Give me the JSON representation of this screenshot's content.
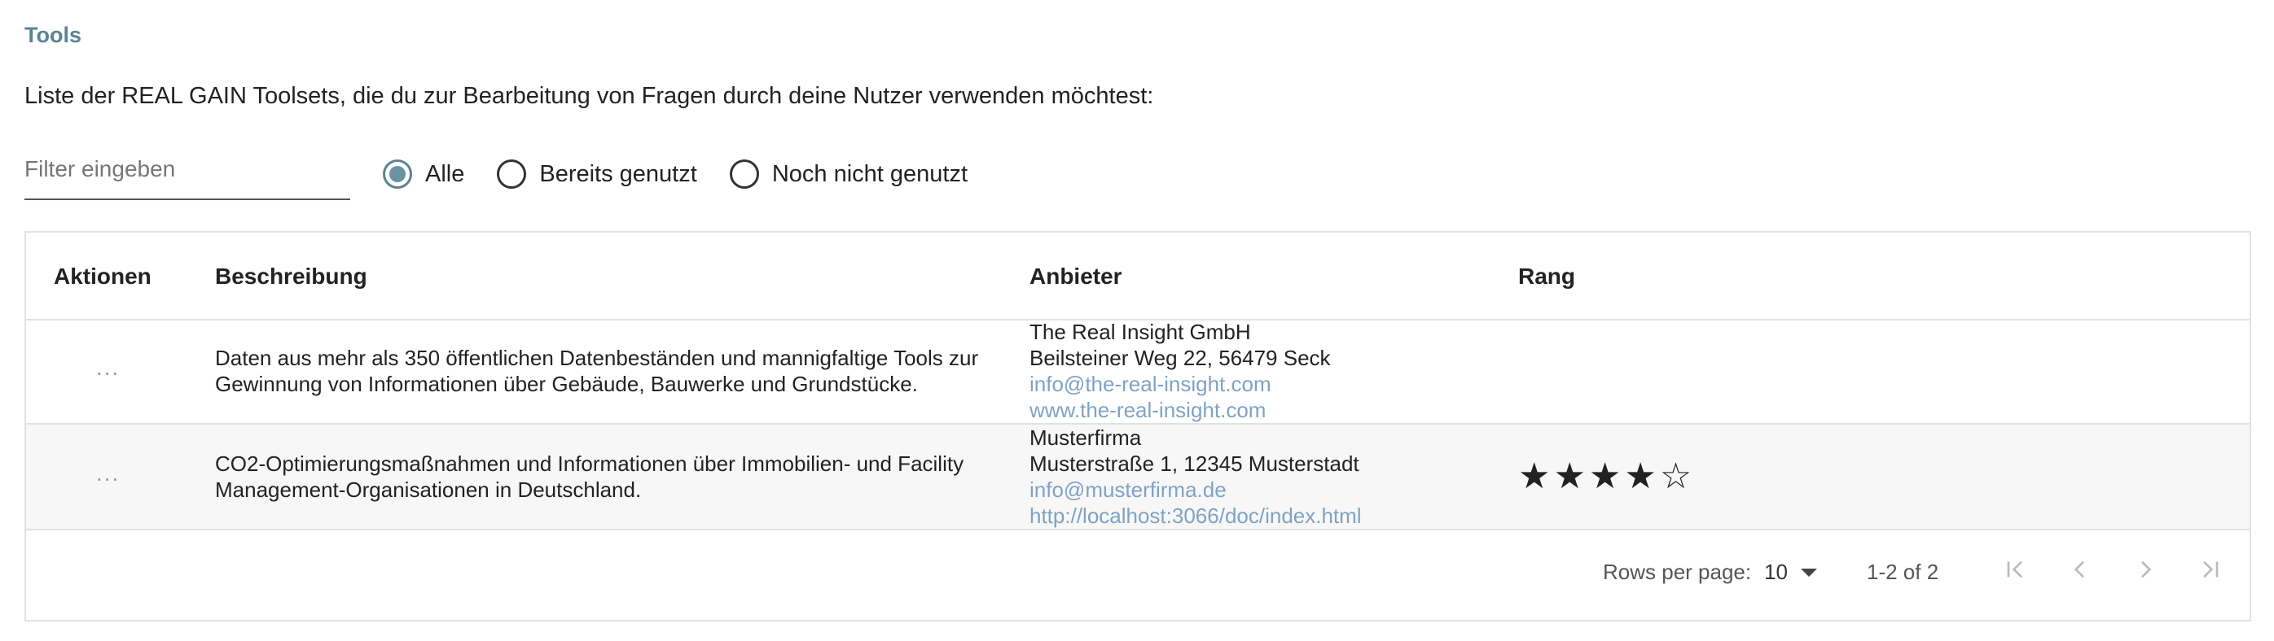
{
  "section_title": "Tools",
  "intro": "Liste der REAL GAIN Toolsets, die du zur Bearbeitung von Fragen durch deine Nutzer verwenden möchtest:",
  "filter": {
    "placeholder": "Filter eingeben",
    "value": ""
  },
  "radios": [
    {
      "label": "Alle",
      "selected": true
    },
    {
      "label": "Bereits genutzt",
      "selected": false
    },
    {
      "label": "Noch nicht genutzt",
      "selected": false
    }
  ],
  "table": {
    "headers": {
      "actions": "Aktionen",
      "description": "Beschreibung",
      "provider": "Anbieter",
      "rank": "Rang"
    },
    "rows": [
      {
        "actions": "...",
        "description": "Daten aus mehr als 350 öffentlichen Datenbeständen und mannigfaltige Tools zur Gewinnung von Informationen über Gebäude, Bauwerke und Grundstücke.",
        "provider_name": "The Real Insight GmbH",
        "provider_address": "Beilsteiner Weg 22, 56479 Seck",
        "provider_email": "info@the-real-insight.com",
        "provider_web": "www.the-real-insight.com",
        "rank_stars": ""
      },
      {
        "actions": "...",
        "description": "CO2-Optimierungsmaßnahmen und Informationen über Immobilien- und Facility Management-Organisationen in Deutschland.",
        "provider_name": "Musterfirma",
        "provider_address": "Musterstraße 1, 12345 Musterstadt",
        "provider_email": "info@musterfirma.de",
        "provider_web": "http://localhost:3066/doc/index.html",
        "rank_stars": "★★★★☆",
        "rank_value": 4,
        "rank_max": 5
      }
    ]
  },
  "pagination": {
    "rows_per_page_label": "Rows per page:",
    "rows_per_page": "10",
    "range": "1-2 of 2"
  },
  "colors": {
    "accent": "#5a8494",
    "link": "#7fa3c4",
    "row_alt": "#f7f7f7"
  }
}
